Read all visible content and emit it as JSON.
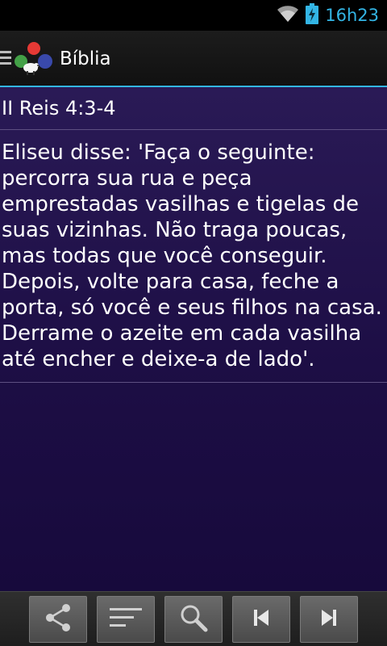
{
  "status_bar": {
    "time": "16h23",
    "wifi_icon": "wifi-icon",
    "battery_icon": "battery-charging-icon",
    "accent_color": "#33b5e5"
  },
  "action_bar": {
    "title": "Bíblia",
    "menu_icon": "drawer-menu-icon",
    "logo_icon": "app-logo-icon"
  },
  "verse": {
    "reference": "II Reis 4:3-4",
    "text": "Eliseu disse: 'Faça o seguinte: percorra sua rua e peça emprestadas vasilhas e tigelas de suas vizinhas. Não traga poucas, mas todas que você conseguir. Depois, volte para casa, feche a porta, só você e seus filhos na casa. Derrame o azeite em cada vasilha até encher e deixe-a de lado'."
  },
  "toolbar": {
    "buttons": [
      {
        "icon": "share-icon"
      },
      {
        "icon": "filter-list-icon"
      },
      {
        "icon": "search-icon"
      },
      {
        "icon": "skip-previous-icon"
      },
      {
        "icon": "skip-next-icon"
      }
    ]
  },
  "colors": {
    "content_background": "#1d0e45",
    "divider": "#5e5082",
    "text": "#ffffff"
  }
}
